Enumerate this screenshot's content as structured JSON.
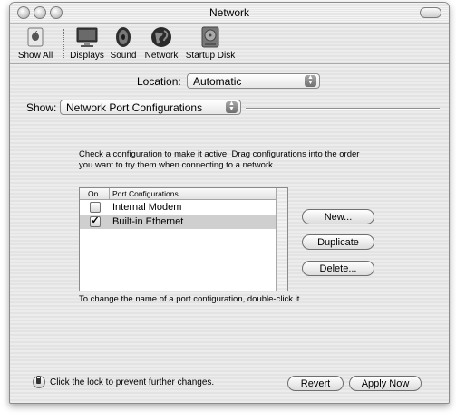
{
  "window": {
    "title": "Network"
  },
  "toolbar": {
    "items": [
      {
        "label": "Show All",
        "icon": "apple-icon"
      },
      {
        "label": "Displays",
        "icon": "display-icon"
      },
      {
        "label": "Sound",
        "icon": "speaker-icon"
      },
      {
        "label": "Network",
        "icon": "globe-icon"
      },
      {
        "label": "Startup Disk",
        "icon": "disk-icon"
      }
    ]
  },
  "location": {
    "label": "Location:",
    "value": "Automatic"
  },
  "show": {
    "label": "Show:",
    "value": "Network Port Configurations"
  },
  "instructions": "Check a configuration to make it active. Drag configurations into the order you want to try them when connecting to a network.",
  "table": {
    "headers": {
      "on": "On",
      "name": "Port Configurations"
    },
    "rows": [
      {
        "name": "Internal Modem",
        "checked": false,
        "selected": false
      },
      {
        "name": "Built-in Ethernet",
        "checked": true,
        "selected": true
      }
    ]
  },
  "buttons": {
    "new": "New...",
    "duplicate": "Duplicate",
    "delete": "Delete...",
    "revert": "Revert",
    "apply": "Apply Now"
  },
  "rename_hint": "To change the name of a port configuration, double-click it.",
  "lock": {
    "text": "Click the lock to prevent further changes."
  },
  "checkmark": "✓"
}
